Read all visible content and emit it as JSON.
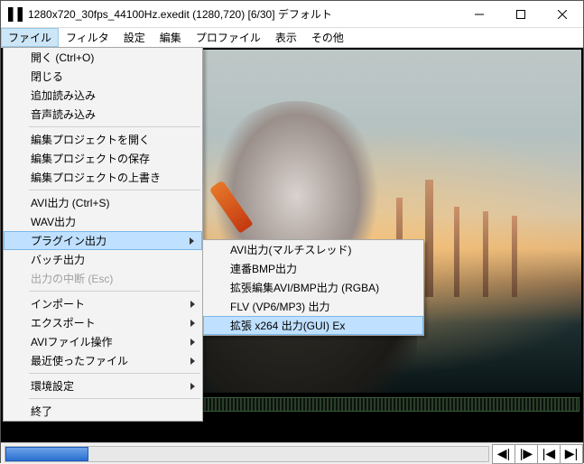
{
  "titlebar": {
    "text": "1280x720_30fps_44100Hz.exedit (1280,720)  [6/30]  デフォルト"
  },
  "menubar": {
    "items": [
      "ファイル",
      "フィルタ",
      "設定",
      "編集",
      "プロファイル",
      "表示",
      "その他"
    ]
  },
  "file_menu": {
    "items": [
      {
        "label": "開く (Ctrl+O)",
        "sub": false,
        "sep": false,
        "disabled": false
      },
      {
        "label": "閉じる",
        "sub": false,
        "sep": false,
        "disabled": false
      },
      {
        "label": "追加読み込み",
        "sub": false,
        "sep": false,
        "disabled": false
      },
      {
        "label": "音声読み込み",
        "sub": false,
        "sep": false,
        "disabled": false
      },
      {
        "sep": true
      },
      {
        "label": "編集プロジェクトを開く",
        "sub": false,
        "sep": false,
        "disabled": false
      },
      {
        "label": "編集プロジェクトの保存",
        "sub": false,
        "sep": false,
        "disabled": false
      },
      {
        "label": "編集プロジェクトの上書き",
        "sub": false,
        "sep": false,
        "disabled": false
      },
      {
        "sep": true
      },
      {
        "label": "AVI出力 (Ctrl+S)",
        "sub": false,
        "sep": false,
        "disabled": false
      },
      {
        "label": "WAV出力",
        "sub": false,
        "sep": false,
        "disabled": false
      },
      {
        "label": "プラグイン出力",
        "sub": true,
        "sep": false,
        "disabled": false,
        "hl": true
      },
      {
        "label": "バッチ出力",
        "sub": false,
        "sep": false,
        "disabled": false
      },
      {
        "label": "出力の中断 (Esc)",
        "sub": false,
        "sep": false,
        "disabled": true
      },
      {
        "sep": true
      },
      {
        "label": "インポート",
        "sub": true,
        "sep": false,
        "disabled": false
      },
      {
        "label": "エクスポート",
        "sub": true,
        "sep": false,
        "disabled": false
      },
      {
        "label": "AVIファイル操作",
        "sub": true,
        "sep": false,
        "disabled": false
      },
      {
        "label": "最近使ったファイル",
        "sub": true,
        "sep": false,
        "disabled": false
      },
      {
        "sep": true
      },
      {
        "label": "環境設定",
        "sub": true,
        "sep": false,
        "disabled": false
      },
      {
        "sep": true
      },
      {
        "label": "終了",
        "sub": false,
        "sep": false,
        "disabled": false
      }
    ]
  },
  "plugin_submenu": {
    "items": [
      {
        "label": "AVI出力(マルチスレッド)",
        "hl": false
      },
      {
        "label": "連番BMP出力",
        "hl": false
      },
      {
        "label": "拡張編集AVI/BMP出力 (RGBA)",
        "hl": false
      },
      {
        "label": "FLV (VP6/MP3) 出力",
        "hl": false
      },
      {
        "label": "拡張 x264 出力(GUI) Ex",
        "hl": true
      }
    ]
  }
}
